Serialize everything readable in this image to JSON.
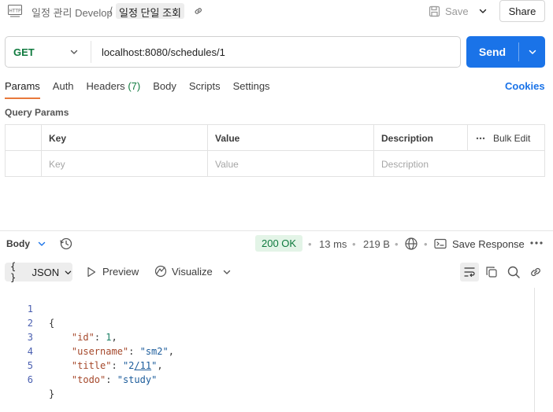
{
  "header": {
    "collection": "일정 관리 Develop",
    "separator": "/",
    "request_name": "일정 단일 조회",
    "save_label": "Save",
    "share_label": "Share"
  },
  "request": {
    "method": "GET",
    "url": "localhost:8080/schedules/1",
    "send_label": "Send"
  },
  "tabs": {
    "params": "Params",
    "auth": "Auth",
    "headers": "Headers",
    "headers_count": "(7)",
    "body": "Body",
    "scripts": "Scripts",
    "settings": "Settings",
    "cookies": "Cookies"
  },
  "query_params": {
    "title": "Query Params",
    "columns": [
      "Key",
      "Value",
      "Description"
    ],
    "bulk_edit": "Bulk Edit",
    "placeholders": {
      "key": "Key",
      "value": "Value",
      "description": "Description"
    }
  },
  "response": {
    "body_label": "Body",
    "status": "200 OK",
    "time": "13 ms",
    "size": "219 B",
    "save_response": "Save Response",
    "format": "JSON",
    "preview": "Preview",
    "visualize": "Visualize",
    "lines": [
      "1",
      "2",
      "3",
      "4",
      "5",
      "6"
    ],
    "json": {
      "open": "{",
      "close": "}",
      "id_key": "\"id\"",
      "id_val": "1",
      "username_key": "\"username\"",
      "username_val": "\"sm2\"",
      "title_key": "\"title\"",
      "title_val_a": "\"2",
      "title_val_b": "/11",
      "title_val_c": "\"",
      "todo_key": "\"todo\"",
      "todo_val": "\"study\""
    }
  },
  "colors": {
    "send": "#1a73e8",
    "method_get": "#0f7a3e",
    "status_ok_bg": "#e3f4e7",
    "active_tab_underline": "#e8793b"
  },
  "icons": [
    "http-icon",
    "link-icon",
    "save-icon",
    "chevron-down-icon",
    "history-icon",
    "globe-icon",
    "save-response-icon",
    "more-icon",
    "json-braces-icon",
    "play-icon",
    "visualize-icon",
    "wrap-lines-icon",
    "copy-icon",
    "search-icon",
    "share-link-icon",
    "dots-icon"
  ]
}
